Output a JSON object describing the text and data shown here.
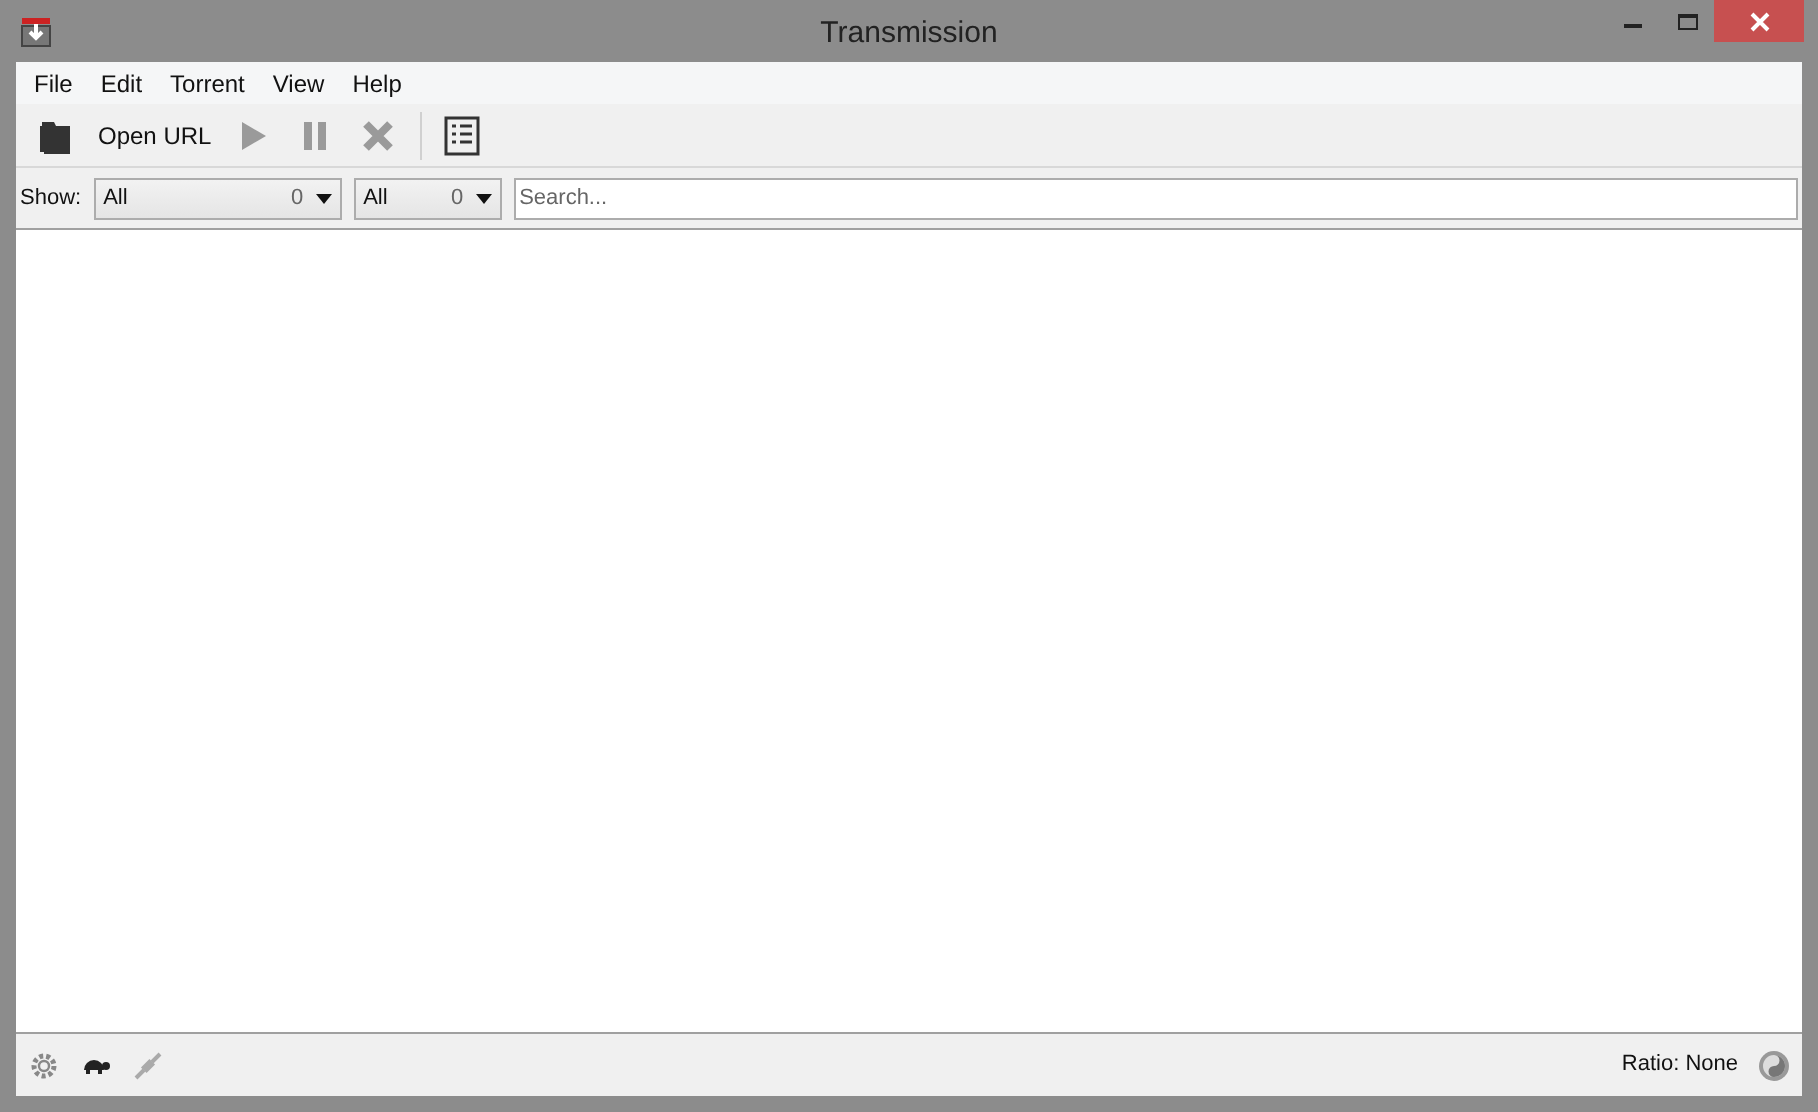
{
  "window": {
    "title": "Transmission"
  },
  "menu": [
    "File",
    "Edit",
    "Torrent",
    "View",
    "Help"
  ],
  "toolbar": [
    {
      "kind": "open",
      "disabled": false
    },
    {
      "kind": "text",
      "label": "Open URL",
      "disabled": false
    },
    {
      "kind": "start",
      "disabled": true
    },
    {
      "kind": "pause",
      "disabled": true
    },
    {
      "kind": "remove",
      "disabled": true
    },
    {
      "kind": "separator"
    },
    {
      "kind": "properties",
      "disabled": false
    }
  ],
  "filter": {
    "label": "Show:",
    "dropdowns": [
      {
        "value": "All",
        "count": "0"
      },
      {
        "value": "All",
        "count": "0"
      }
    ],
    "search": {
      "placeholder": "Search..."
    }
  },
  "status_bar": {
    "ratio": "Ratio: None"
  }
}
